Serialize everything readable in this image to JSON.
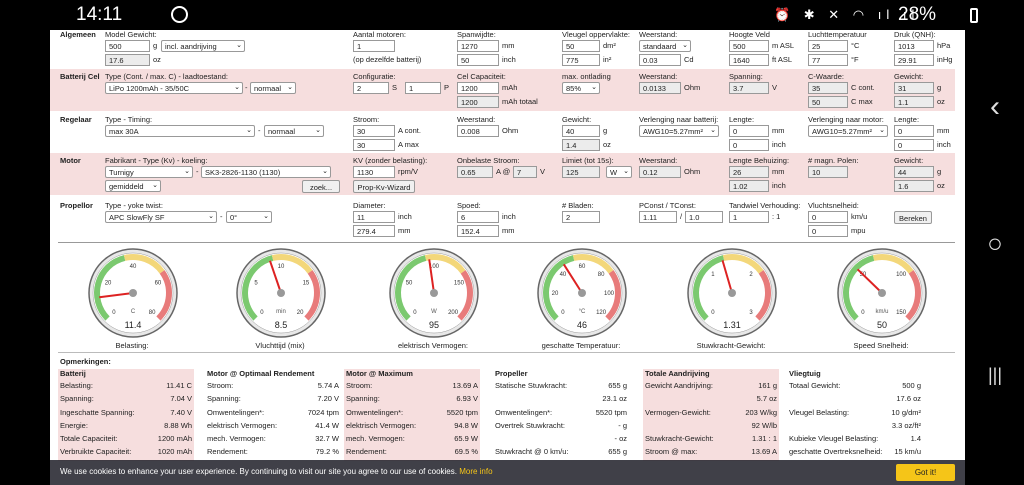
{
  "status": {
    "time": "14:11",
    "battery": "28%"
  },
  "rows": {
    "algemeen": {
      "section": "Algemeen",
      "model_label": "Model Gewicht:",
      "weight": "500",
      "weight_unit": "g",
      "drive_sel": "incl. aandrijving",
      "weight2": "17.6",
      "weight2_unit": "oz",
      "motors_label": "Aantal motoren:",
      "motors": "1",
      "motors_note": "(op dezelfde batterij)",
      "span_label": "Spanwijdte:",
      "span_mm": "1270",
      "span_in": "50",
      "mm": "mm",
      "inch": "inch",
      "area_label": "Vleugel oppervlakte:",
      "area_dm": "50",
      "area_in": "775",
      "dm2": "dm²",
      "in2": "in²",
      "res_label": "Weerstand:",
      "res_sel": "standaard",
      "cd": "0.03",
      "cd_unit": "Cd",
      "alt_label": "Hoogte Veld",
      "alt_m": "500",
      "alt_ft": "1640",
      "m_asl": "m ASL",
      "ft_asl": "ft ASL",
      "temp_label": "Luchttemperatuur",
      "temp_c": "25",
      "temp_f": "77",
      "deg_c": "°C",
      "deg_f": "°F",
      "press_label": "Druk (QNH):",
      "press_hpa": "1013",
      "press_inhg": "29.91",
      "hpa": "hPa",
      "inhg": "inHg"
    },
    "batterij": {
      "section": "Batterij Cel",
      "type_label": "Type (Cont. / max. C) - laadtoestand:",
      "type_sel": "LiPo 1200mAh - 35/50C",
      "dash": "-",
      "state_sel": "normaal",
      "conf_label": "Configuratie:",
      "s": "2",
      "s_unit": "S",
      "p": "1",
      "p_unit": "P",
      "cap_label": "Cel Capaciteit:",
      "cap": "1200",
      "cap_unit": "mAh",
      "cap_tot": "1200",
      "cap_tot_unit": "mAh totaal",
      "dis_label": "max. ontlading",
      "dis_sel": "85%",
      "res_label": "Weerstand:",
      "res": "0.0133",
      "ohm": "Ohm",
      "volt_label": "Spanning:",
      "volt": "3.7",
      "v": "V",
      "c_label": "C-Waarde:",
      "c_cont": "35",
      "c_max": "50",
      "c_cont_unit": "C cont.",
      "c_max_unit": "C max",
      "w_label": "Gewicht:",
      "w_g": "31",
      "w_oz": "1.1",
      "g": "g",
      "oz": "oz"
    },
    "regelaar": {
      "section": "Regelaar",
      "type_label": "Type - Timing:",
      "type_sel": "max 30A",
      "dash": "-",
      "timing_sel": "normaal",
      "cur_label": "Stroom:",
      "cur_cont": "30",
      "cur_max": "30",
      "a_cont": "A cont.",
      "a_max": "A max",
      "res_label": "Weerstand:",
      "res": "0.008",
      "ohm": "Ohm",
      "w_label": "Gewicht:",
      "w_g": "40",
      "w_oz": "1.4",
      "g": "g",
      "oz": "oz",
      "ext_label": "Verlenging naar batterij:",
      "ext_sel": "AWG10=5.27mm²",
      "len_label": "Lengte:",
      "len_mm": "0",
      "len_in": "0",
      "mm": "mm",
      "inch": "inch",
      "ext2_label": "Verlenging naar motor:",
      "ext2_sel": "AWG10=5.27mm²",
      "len2_label": "Lengte:",
      "len2_mm": "0",
      "len2_in": "0"
    },
    "motor": {
      "section": "Motor",
      "type_label": "Fabrikant - Type (Kv) - koeling:",
      "maker_sel": "Turnigy",
      "dash": "-",
      "type_sel": "SK3-2826-1130 (1130)",
      "cool_sel": "gemiddeld",
      "zoek": "zoek...",
      "kv_label": "KV (zonder belasting):",
      "kv": "1130",
      "kv_unit": "rpm/V",
      "kv_btn": "Prop-Kv-Wizard",
      "noload_label": "Onbelaste Stroom:",
      "noload_a": "0.65",
      "noload_at": "A @",
      "noload_v": "7",
      "v": "V",
      "lim_label": "Limiet (tot 15s):",
      "lim": "125",
      "lim_sel": "W",
      "res_label": "Weerstand:",
      "res": "0.12",
      "ohm": "Ohm",
      "lenh_label": "Lengte Behuizing:",
      "lenh_mm": "26",
      "lenh_in": "1.02",
      "mm": "mm",
      "inch": "inch",
      "poles_label": "# magn. Polen:",
      "poles": "10",
      "w_label": "Gewicht:",
      "w_g": "44",
      "w_oz": "1.6",
      "g": "g",
      "oz": "oz"
    },
    "propellor": {
      "section": "Propellor",
      "type_label": "Type - yoke twist:",
      "type_sel": "APC SlowFly SF",
      "dash": "-",
      "twist_sel": "0°",
      "dia_label": "Diameter:",
      "dia_in": "11",
      "dia_mm": "279.4",
      "inch": "inch",
      "mm": "mm",
      "pitch_label": "Spoed:",
      "pitch_in": "6",
      "pitch_mm": "152.4",
      "blades_label": "# Bladen:",
      "blades": "2",
      "pc_label": "PConst / TConst:",
      "pconst": "1.11",
      "slash": "/",
      "tconst": "1.0",
      "gear_label": "Tandwiel Verhouding:",
      "gear": "1",
      "gear_unit": ": 1",
      "speed_label": "Vluchtsnelheid:",
      "speed_kmh": "0",
      "speed_mph": "0",
      "kmh": "km/u",
      "mph": "mpu",
      "calc": "Bereken"
    }
  },
  "gauges": [
    {
      "caption": "Belasting:",
      "value": "11.4",
      "unit": "C",
      "ticks": [
        "0",
        "20",
        "40",
        "60",
        "80"
      ],
      "frac": 0.14
    },
    {
      "caption": "Vluchttijd (mix)",
      "value": "8.5",
      "unit": "min",
      "ticks": [
        "0",
        "5",
        "10",
        "15",
        "20"
      ],
      "frac": 0.43
    },
    {
      "caption": "elektrisch Vermogen:",
      "value": "95",
      "unit": "W",
      "ticks": [
        "0",
        "50",
        "100",
        "150",
        "200"
      ],
      "frac": 0.47
    },
    {
      "caption": "geschatte Temperatuur:",
      "value": "46",
      "unit": "°C",
      "ticks": [
        "0",
        "20",
        "40",
        "60",
        "80",
        "100",
        "120"
      ],
      "frac": 0.38
    },
    {
      "caption": "Stuwkracht-Gewicht:",
      "value": "1.31",
      "unit": "",
      "ticks": [
        "0",
        "1",
        "2",
        "3"
      ],
      "frac": 0.44
    },
    {
      "caption": "Speed Snelheid:",
      "value": "50",
      "unit": "km/u",
      "ticks": [
        "0",
        "50",
        "100",
        "150"
      ],
      "frac": 0.33
    }
  ],
  "remarks": {
    "title": "Opmerkingen:",
    "cols": [
      {
        "title": "Batterij",
        "hl": true,
        "rows": [
          [
            "Belasting:",
            "11.41 C"
          ],
          [
            "Spanning:",
            "7.04 V"
          ],
          [
            "Ingeschatte Spanning:",
            "7.40 V"
          ],
          [
            "Energie:",
            "8.88 Wh"
          ],
          [
            "Totale Capaciteit:",
            "1200 mAh"
          ],
          [
            "Verbruikte Capaciteit:",
            "1020 mAh"
          ]
        ]
      },
      {
        "title": "Motor @ Optimaal Rendement",
        "hl": false,
        "rows": [
          [
            "Stroom:",
            "5.74 A"
          ],
          [
            "Spanning:",
            "7.20 V"
          ],
          [
            "Omwentelingen*:",
            "7024 tpm"
          ],
          [
            "elektrisch Vermogen:",
            "41.4 W"
          ],
          [
            "mech. Vermogen:",
            "32.7 W"
          ],
          [
            "Rendement:",
            "79.2 %"
          ]
        ]
      },
      {
        "title": "Motor @ Maximum",
        "hl": true,
        "rows": [
          [
            "Stroom:",
            "13.69 A"
          ],
          [
            "Spanning:",
            "6.93 V"
          ],
          [
            "Omwentelingen*:",
            "5520 tpm"
          ],
          [
            "elektrisch Vermogen:",
            "94.8 W"
          ],
          [
            "mech. Vermogen:",
            "65.9 W"
          ],
          [
            "Rendement:",
            "69.5 %"
          ]
        ]
      },
      {
        "title": "Propeller",
        "hl": false,
        "rows": [
          [
            "Statische Stuwkracht:",
            "655 g"
          ],
          [
            "",
            "23.1 oz"
          ],
          [
            "Omwentelingen*:",
            "5520 tpm"
          ],
          [
            "Overtrek Stuwkracht:",
            "- g"
          ],
          [
            "",
            "- oz"
          ],
          [
            "Stuwkracht @ 0 km/u:",
            "655 g"
          ]
        ]
      },
      {
        "title": "Totale Aandrijving",
        "hl": true,
        "rows": [
          [
            "Gewicht Aandrijving:",
            "161 g"
          ],
          [
            "",
            "5.7 oz"
          ],
          [
            "Vermogen-Gewicht:",
            "203 W/kg"
          ],
          [
            "",
            "92 W/lb"
          ],
          [
            "Stuwkracht-Gewicht:",
            "1.31 : 1"
          ],
          [
            "Stroom @ max:",
            "13.69 A"
          ]
        ]
      },
      {
        "title": "Vliegtuig",
        "hl": false,
        "rows": [
          [
            "Totaal Gewicht:",
            "500 g"
          ],
          [
            "",
            "17.6 oz"
          ],
          [
            "Vleugel Belasting:",
            "10 g/dm²"
          ],
          [
            "",
            "3.3 oz/ft²"
          ],
          [
            "Kubieke Vleugel Belasting:",
            "1.4"
          ],
          [
            "geschatte Overtreksnelheid:",
            "15 km/u"
          ]
        ]
      }
    ]
  },
  "cookie": {
    "text": "We use cookies to enhance your user experience. By continuing to visit our site you agree to our use of cookies.",
    "more": "More info",
    "btn": "Got it!"
  },
  "nav": {
    "back": "‹",
    "home": "○",
    "recent": "|||"
  }
}
